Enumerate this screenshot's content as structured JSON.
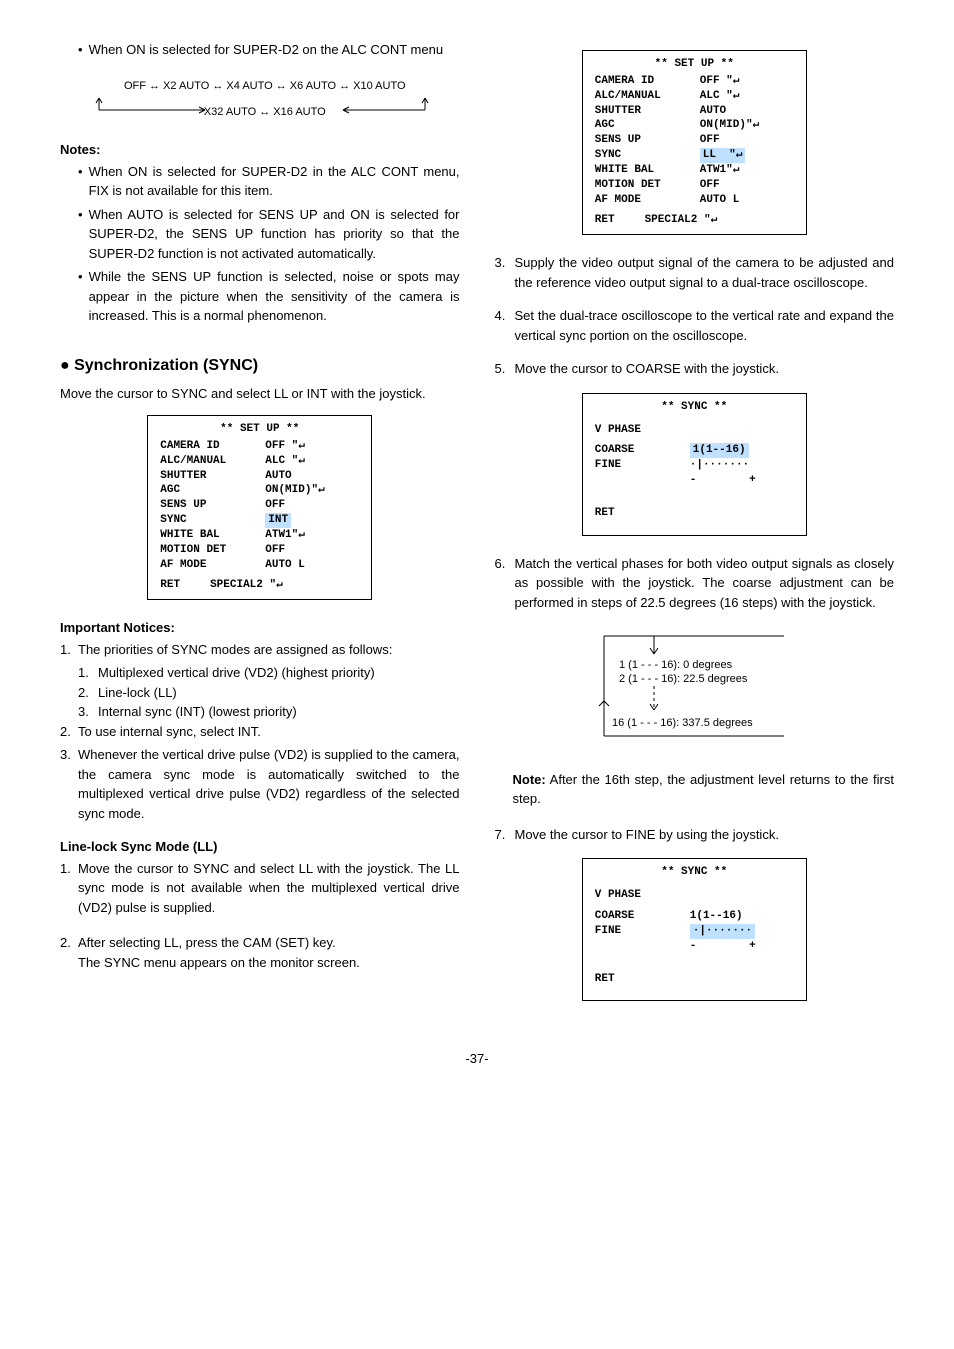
{
  "left": {
    "bullet1": "When ON is selected for SUPER-D2 on the ALC CONT menu",
    "flow": {
      "line1": "OFF ↔ X2 AUTO ↔ X4 AUTO ↔ X6 AUTO ↔ X10 AUTO",
      "line2": "X32 AUTO ↔ X16 AUTO"
    },
    "notesHeader": "Notes:",
    "notes": [
      "When ON is selected for SUPER-D2 in the ALC CONT menu, FIX is not available for this item.",
      "When AUTO is selected for SENS UP and ON is selected for SUPER-D2, the SENS UP function has priority so that the SUPER-D2 function is not activated automatically.",
      "While the SENS UP function is selected, noise or spots may appear in the picture when the sensitivity of the camera is increased. This is a normal phenomenon."
    ],
    "syncHeader": "Synchronization (SYNC)",
    "syncIntro": "Move the cursor to SYNC and select LL or INT with the joystick.",
    "menu1": {
      "title": "** SET UP **",
      "rows": [
        {
          "label": "CAMERA ID",
          "val": "OFF \"↵"
        },
        {
          "label": "ALC/MANUAL",
          "val": "ALC \"↵"
        },
        {
          "label": "SHUTTER",
          "val": "AUTO"
        },
        {
          "label": "AGC",
          "val": "ON(MID)\"↵"
        },
        {
          "label": "SENS UP",
          "val": "OFF"
        },
        {
          "label": "SYNC",
          "val": "INT",
          "hl": true
        },
        {
          "label": "WHITE BAL",
          "val": "ATW1\"↵"
        },
        {
          "label": "MOTION DET",
          "val": "OFF"
        },
        {
          "label": "AF MODE",
          "val": "AUTO L"
        }
      ],
      "footer": {
        "ret": "RET",
        "special": "SPECIAL2 \"↵"
      }
    },
    "impHeader": "Important Notices:",
    "imp1": "The priorities of SYNC modes are assigned as follows:",
    "impSub": [
      "Multiplexed vertical drive (VD2) (highest priority)",
      "Line-lock (LL)",
      "Internal sync (INT) (lowest priority)"
    ],
    "imp2": "To use internal sync, select INT.",
    "imp3": "Whenever the vertical drive pulse (VD2) is supplied to the camera, the camera sync mode is automatically switched to the multiplexed vertical drive pulse (VD2) regardless of the selected sync mode.",
    "llHeader": "Line-lock Sync Mode (LL)",
    "ll1": "Move the cursor to SYNC and select LL with the joystick. The LL sync mode is not available when the multiplexed vertical drive (VD2) pulse is supplied.",
    "ll2a": "After selecting LL, press the CAM (SET) key.",
    "ll2b": "The SYNC menu appears on the monitor screen."
  },
  "right": {
    "menu2": {
      "title": "** SET UP **",
      "rows": [
        {
          "label": "CAMERA ID",
          "val": "OFF \"↵"
        },
        {
          "label": "ALC/MANUAL",
          "val": "ALC \"↵"
        },
        {
          "label": "SHUTTER",
          "val": "AUTO"
        },
        {
          "label": "AGC",
          "val": "ON(MID)\"↵"
        },
        {
          "label": "SENS UP",
          "val": "OFF"
        },
        {
          "label": "SYNC",
          "val": "LL  \"↵",
          "hl": true
        },
        {
          "label": "WHITE BAL",
          "val": "ATW1\"↵"
        },
        {
          "label": "MOTION DET",
          "val": "OFF"
        },
        {
          "label": "AF MODE",
          "val": "AUTO L"
        }
      ],
      "footer": {
        "ret": "RET",
        "special": "SPECIAL2 \"↵"
      }
    },
    "step3": "Supply the video output signal of the camera to be adjusted and the reference video output signal to a dual-trace oscilloscope.",
    "step4": "Set the dual-trace oscilloscope to the vertical rate and expand the vertical sync portion on the oscilloscope.",
    "step5": "Move the cursor to COARSE with the joystick.",
    "syncMenu1": {
      "title": "** SYNC **",
      "vphase": "V PHASE",
      "coarseLabel": "COARSE",
      "coarseVal": "1(1--16)",
      "fineLabel": "FINE",
      "fineVal": "·|·······",
      "fineScale": "-        +",
      "ret": "RET"
    },
    "step6": "Match the vertical phases for both video output signals as closely as possible with the joystick. The coarse adjustment can be performed in steps of 22.5 degrees (16 steps) with the joystick.",
    "degrees": {
      "line1": "1 (1 - - - 16): 0 degrees",
      "line2": "2 (1 - - - 16): 22.5 degrees",
      "line3": "16 (1 - - - 16): 337.5 degrees"
    },
    "noteLabel": "Note:",
    "noteText": " After the 16th step, the adjustment level returns to the first step.",
    "step7": "Move the cursor to FINE by using the joystick.",
    "syncMenu2": {
      "title": "** SYNC **",
      "vphase": "V PHASE",
      "coarseLabel": "COARSE",
      "coarseVal": "1(1--16)",
      "fineLabel": "FINE",
      "fineVal": "·|·······",
      "fineScale": "-        +",
      "ret": "RET"
    }
  },
  "pageNum": "-37-"
}
